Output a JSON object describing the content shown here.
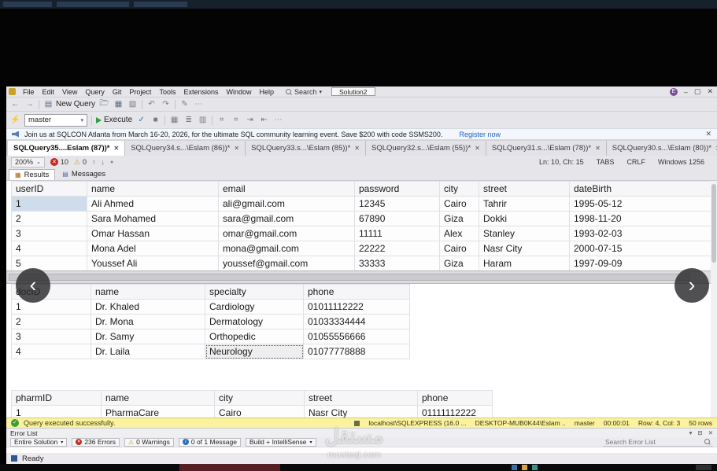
{
  "menu": {
    "items": [
      "File",
      "Edit",
      "View",
      "Query",
      "Git",
      "Project",
      "Tools",
      "Extensions",
      "Window",
      "Help"
    ],
    "search_label": "Search",
    "solution_label": "Solution2",
    "minimize": "–",
    "maximize": "▢",
    "close": "✕",
    "avatar_initial": "E"
  },
  "toolbar1": {
    "new_query_label": "New Query"
  },
  "toolbar2": {
    "database": "master",
    "execute_label": "Execute"
  },
  "notification": {
    "text": "Join us at SQLCON Atlanta from March 16-20, 2026, for the ultimate SQL community learning event. Save $200 with code SSMS200.",
    "link": "Register now"
  },
  "tabs": [
    {
      "label": "SQLQuery35....Eslam (87))*"
    },
    {
      "label": "SQLQuery34.s...\\Eslam (86))*"
    },
    {
      "label": "SQLQuery33.s...\\Eslam (85))*"
    },
    {
      "label": "SQLQuery32.s...\\Eslam (55))*"
    },
    {
      "label": "SQLQuery31.s...\\Eslam (78))*"
    },
    {
      "label": "SQLQuery30.s...\\Eslam (80))*"
    }
  ],
  "editor_bar": {
    "zoom": "200%",
    "errors": "10",
    "warnings": "0",
    "position": "Ln: 10, Ch: 15",
    "tabs_label": "TABS",
    "line_ending": "CRLF",
    "encoding": "Windows 1256"
  },
  "results_tabs": {
    "results": "Results",
    "messages": "Messages"
  },
  "grids": [
    {
      "columns": [
        "userID",
        "name",
        "email",
        "password",
        "city",
        "street",
        "dateBirth"
      ],
      "rows": [
        [
          "1",
          "Ali Ahmed",
          "ali@gmail.com",
          "12345",
          "Cairo",
          "Tahrir",
          "1995-05-12"
        ],
        [
          "2",
          "Sara Mohamed",
          "sara@gmail.com",
          "67890",
          "Giza",
          "Dokki",
          "1998-11-20"
        ],
        [
          "3",
          "Omar Hassan",
          "omar@gmail.com",
          "11111",
          "Alex",
          "Stanley",
          "1993-02-03"
        ],
        [
          "4",
          "Mona Adel",
          "mona@gmail.com",
          "22222",
          "Cairo",
          "Nasr City",
          "2000-07-15"
        ],
        [
          "5",
          "Youssef Ali",
          "youssef@gmail.com",
          "33333",
          "Giza",
          "Haram",
          "1997-09-09"
        ]
      ]
    },
    {
      "columns": [
        "docID",
        "name",
        "specialty",
        "phone"
      ],
      "rows": [
        [
          "1",
          "Dr. Khaled",
          "Cardiology",
          "01011112222"
        ],
        [
          "2",
          "Dr. Mona",
          "Dermatology",
          "01033334444"
        ],
        [
          "3",
          "Dr. Samy",
          "Orthopedic",
          "01055556666"
        ],
        [
          "4",
          "Dr. Laila",
          "Neurology",
          "01077778888"
        ]
      ]
    },
    {
      "columns": [
        "pharmID",
        "name",
        "city",
        "street",
        "phone"
      ],
      "rows": [
        [
          "1",
          "PharmaCare",
          "Cairo",
          "Nasr City",
          "01111112222"
        ]
      ]
    }
  ],
  "query_status": {
    "message": "Query executed successfully.",
    "server": "localhost\\SQLEXPRESS (16.0 ...",
    "user": "DESKTOP-MUB0K44\\Eslam ..",
    "database": "master",
    "duration": "00:00:01",
    "cursor": "Row: 4, Col: 3",
    "rows": "50 rows"
  },
  "error_list": {
    "title": "Error List",
    "scope": "Entire Solution",
    "errors": "236 Errors",
    "warnings": "0 Warnings",
    "messages": "0 of 1 Message",
    "filter": "Build + IntelliSense",
    "search_placeholder": "Search Error List"
  },
  "status": {
    "ready": "Ready"
  },
  "overlay": {
    "watermark_title": "مستقل",
    "watermark_domain": "mostaql.com"
  }
}
